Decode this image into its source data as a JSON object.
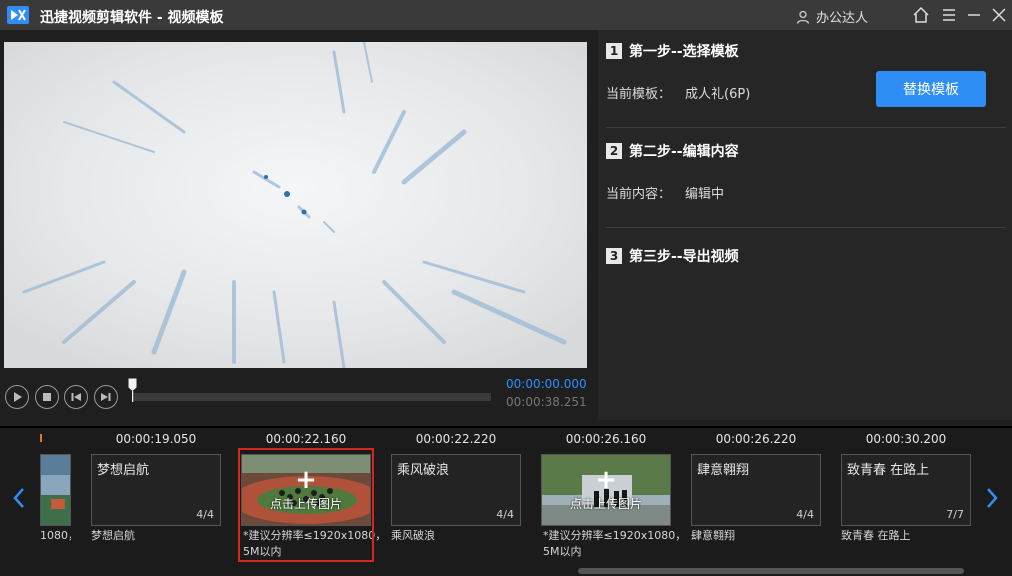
{
  "app": {
    "title": "迅捷视频剪辑软件 - 视频模板",
    "user_name": "办公达人"
  },
  "player": {
    "time_current": "00:00:00.000",
    "time_total": "00:00:38.251",
    "progress": 0
  },
  "steps": [
    {
      "num": "1",
      "title": "第一步--选择模板",
      "row_label": "当前模板：",
      "row_value": "成人礼(6P)",
      "button": "替换模板"
    },
    {
      "num": "2",
      "title": "第二步--编辑内容",
      "row_label": "当前内容：",
      "row_value": "编辑中"
    },
    {
      "num": "3",
      "title": "第三步--导出视频"
    }
  ],
  "timeline": {
    "partial_caption": "1080，",
    "items": [
      {
        "time": "00:00:19.050",
        "type": "text",
        "title": "梦想启航",
        "count": "4/4",
        "caption": "梦想启航"
      },
      {
        "time": "00:00:22.160",
        "type": "photo",
        "upload_label": "点击上传图片",
        "caption_line1": "*建议分辨率≤1920x1080，",
        "caption_line2": "5M以内"
      },
      {
        "time": "00:00:22.220",
        "type": "text",
        "title": "乘风破浪",
        "count": "4/4",
        "caption": "乘风破浪"
      },
      {
        "time": "00:00:26.160",
        "type": "photo",
        "upload_label": "点击上传图片",
        "caption_line1": "*建议分辨率≤1920x1080，",
        "caption_line2": "5M以内"
      },
      {
        "time": "00:00:26.220",
        "type": "text",
        "title": "肆意翱翔",
        "count": "4/4",
        "caption": "肆意翱翔"
      },
      {
        "time": "00:00:30.200",
        "type": "text",
        "title": "致青春 在路上",
        "count": "7/7",
        "caption": "致青春 在路上"
      }
    ]
  },
  "colors": {
    "accent": "#2f8ef5",
    "selection": "#d9261c",
    "time_blue": "#2e8fff"
  }
}
